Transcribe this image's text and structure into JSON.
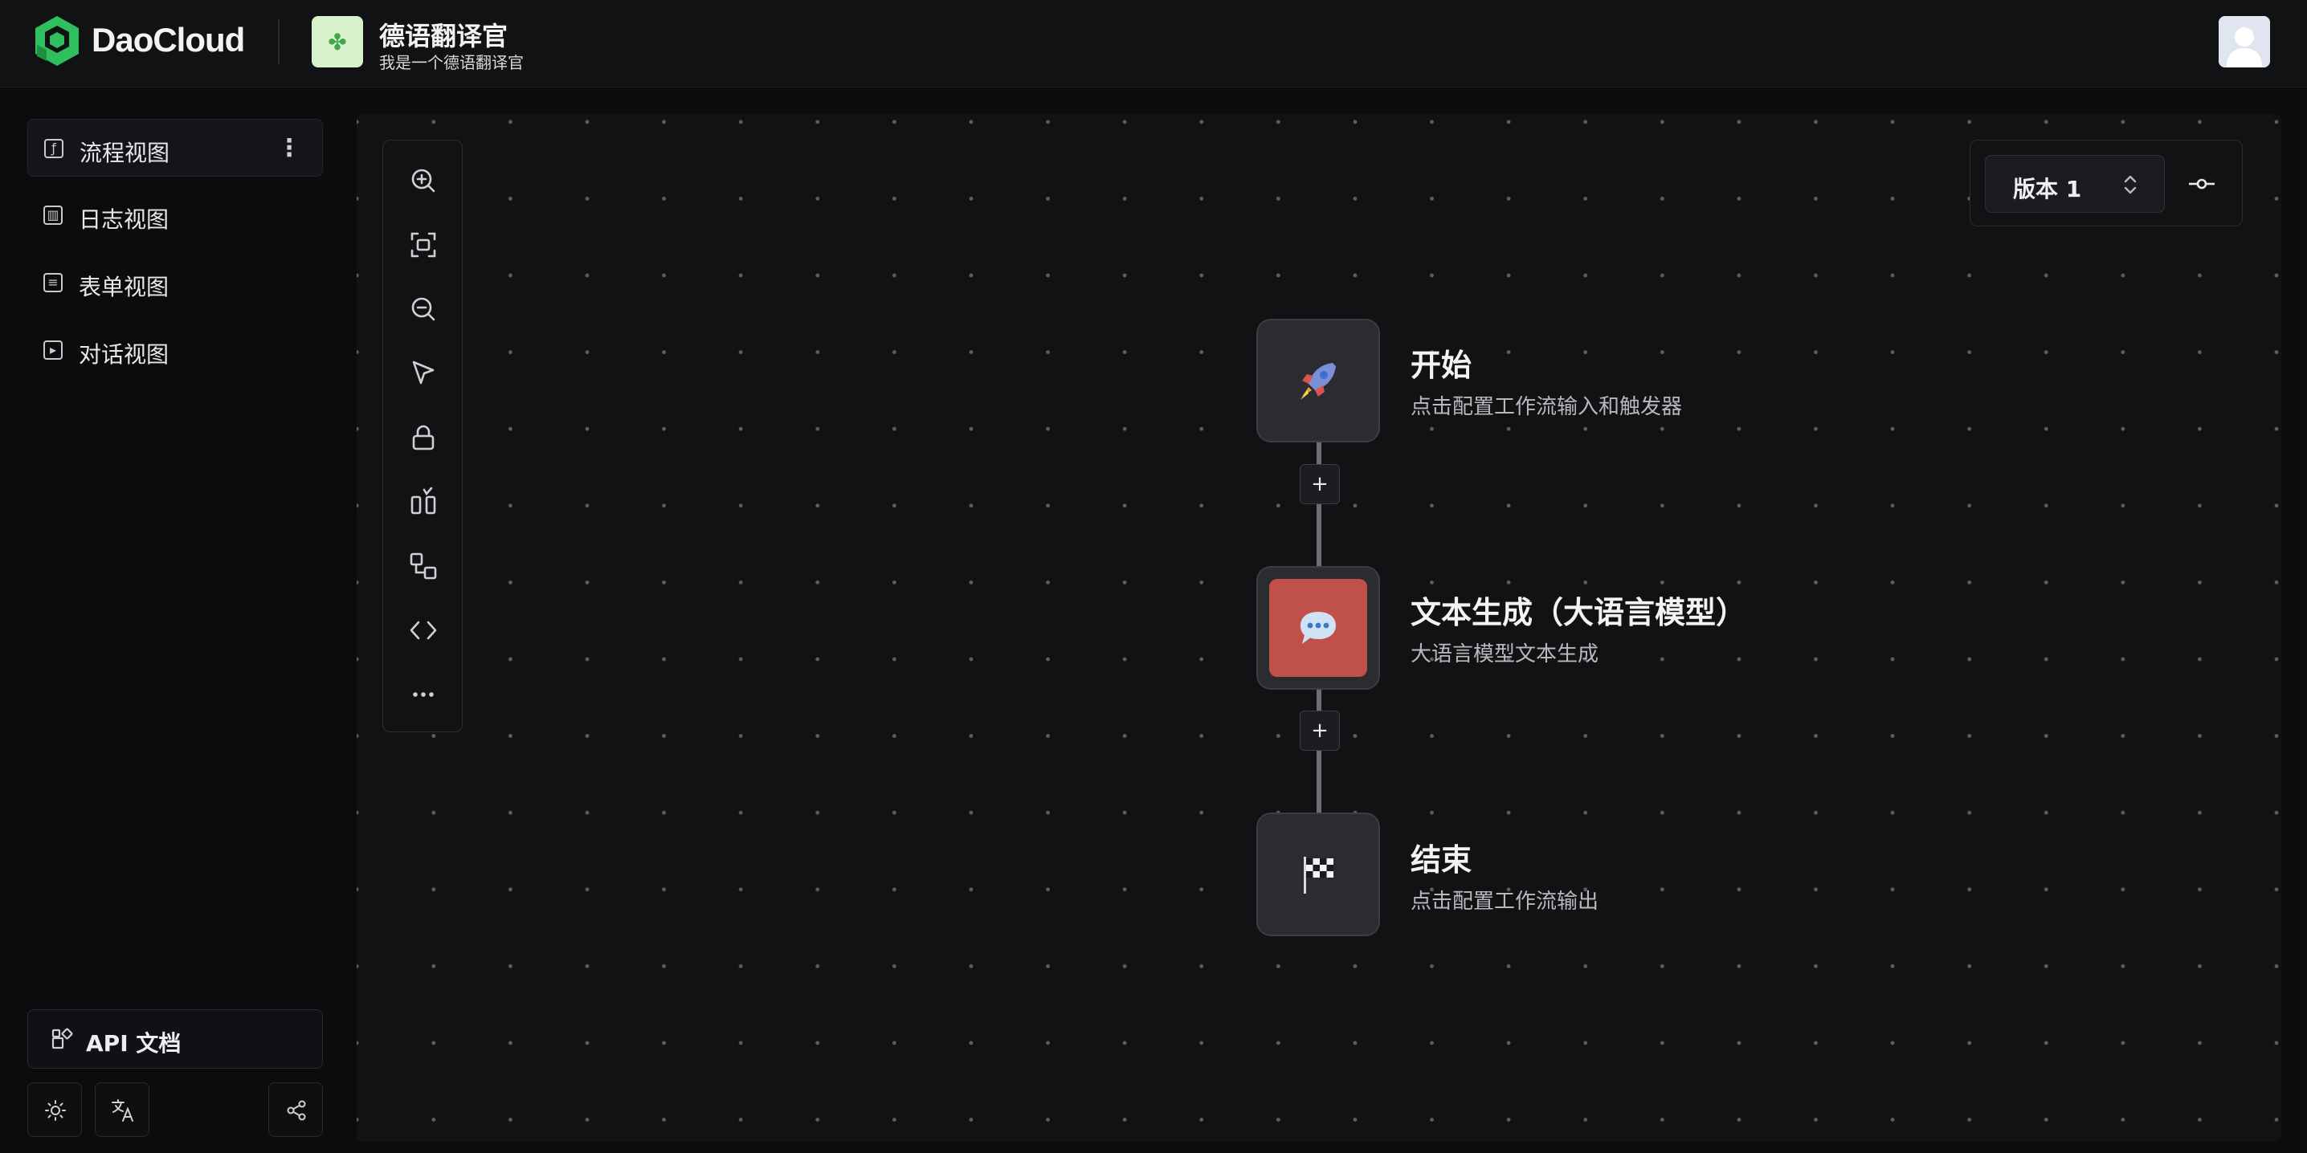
{
  "header": {
    "brand": "DaoCloud",
    "app_icon": "four-leaf-clover-icon",
    "app_title": "德语翻译官",
    "app_subtitle": "我是一个德语翻译官"
  },
  "sidebar": {
    "items": [
      {
        "label": "流程视图",
        "icon": "workflow-icon",
        "active": true
      },
      {
        "label": "日志视图",
        "icon": "log-icon",
        "active": false
      },
      {
        "label": "表单视图",
        "icon": "form-icon",
        "active": false
      },
      {
        "label": "对话视图",
        "icon": "chat-icon",
        "active": false
      }
    ],
    "api_docs_label": "API 文档",
    "footer_icons": [
      "theme-icon",
      "translate-icon",
      "share-icon"
    ]
  },
  "toolbar": {
    "tools": [
      "zoom-in-icon",
      "fit-view-icon",
      "zoom-out-icon",
      "pointer-icon",
      "lock-icon",
      "layout-icon",
      "add-node-icon",
      "code-icon",
      "more-icon"
    ]
  },
  "version": {
    "label": "版本 1"
  },
  "nodes": [
    {
      "title": "开始",
      "description": "点击配置工作流输入和触发器",
      "icon": "rocket-icon"
    },
    {
      "title": "文本生成（大语言模型）",
      "description": "大语言模型文本生成",
      "icon": "speech-bubble-icon"
    },
    {
      "title": "结束",
      "description": "点击配置工作流输出",
      "icon": "checkered-flag-icon"
    }
  ],
  "plus_label": "+",
  "colors": {
    "background": "#0b0c0e",
    "canvas": "#111214",
    "llm_node": "#c0504a",
    "brand_green": "#2fbf5e",
    "app_icon_bg": "#d8f2cd"
  }
}
